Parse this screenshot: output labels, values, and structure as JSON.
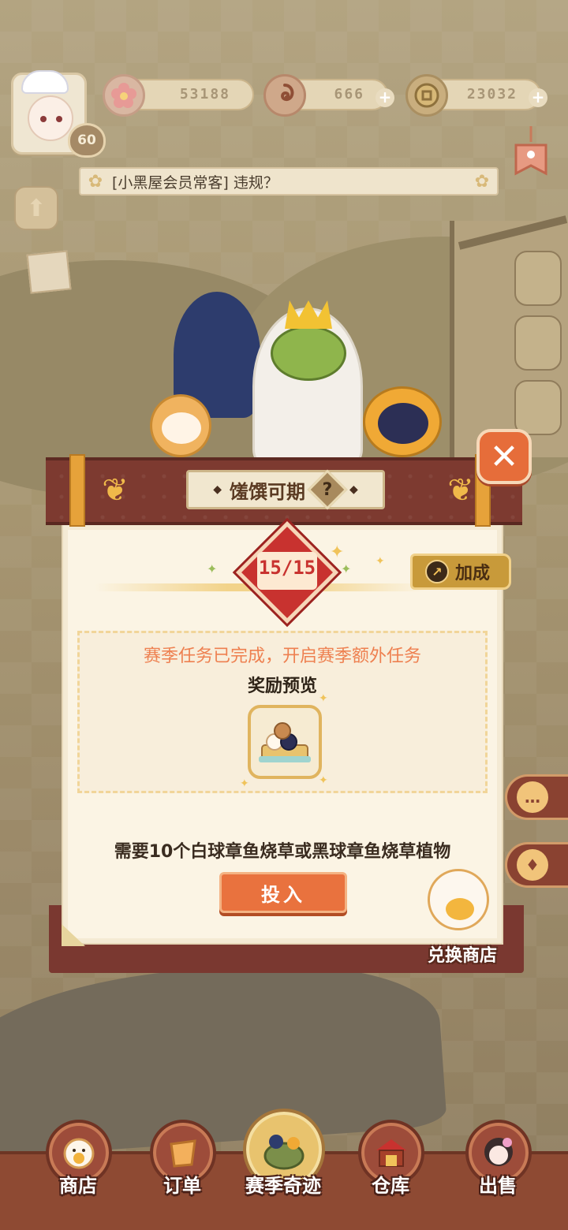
{
  "hud": {
    "level": "60",
    "currencies": [
      {
        "name": "blossom",
        "value": "53188"
      },
      {
        "name": "swirl",
        "value": "666"
      },
      {
        "name": "coin",
        "value": "23032"
      }
    ],
    "notice": "[小黑屋会员常客] 违规？"
  },
  "modal": {
    "title": "馐馔可期",
    "help_label": "?",
    "close_label": "✕",
    "progress": "15/15",
    "bonus_label": "加成",
    "season_message": "赛季任务已完成，开启赛季额外任务",
    "reward_preview_label": "奖励预览",
    "requirement": "需要10个白球章鱼烧草或黑球章鱼烧草植物",
    "submit_label": "投入",
    "exchange_shop_label": "兑换商店"
  },
  "bottom_nav": [
    {
      "label": "商店",
      "icon": "lucky-cat-icon"
    },
    {
      "label": "订单",
      "icon": "order-icon"
    },
    {
      "label": "赛季奇迹",
      "icon": "season-icon",
      "active": true
    },
    {
      "label": "仓库",
      "icon": "warehouse-icon"
    },
    {
      "label": "出售",
      "icon": "sell-icon"
    }
  ],
  "colors": {
    "accent_red": "#7d3a30",
    "accent_orange": "#e9723e",
    "season_text": "#ee8050",
    "progress_red": "#c8322f"
  }
}
